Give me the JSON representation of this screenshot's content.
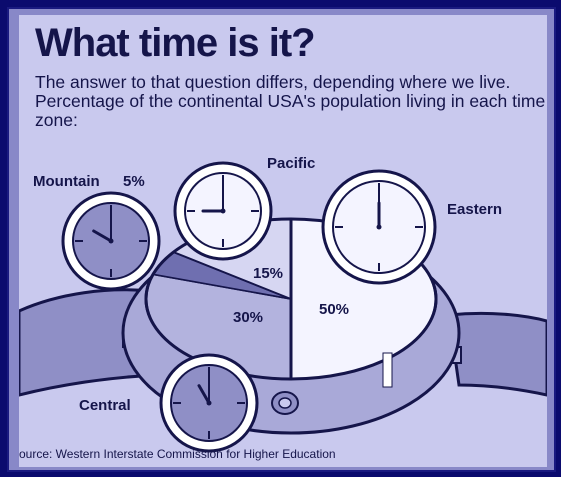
{
  "title": "What time is it?",
  "subtitle": "The answer to that question differs, depending where we live. Percentage of the continental USA's population living in each time zone:",
  "source": "ource:  Western Interstate Commission for Higher Education",
  "colors": {
    "background": "#c9c9ee",
    "ink": "#15154a",
    "band": "#8f8fc6",
    "face_light": "#f4f4ff"
  },
  "chart_data": {
    "type": "pie",
    "title": "What time is it?",
    "categories": [
      "Eastern",
      "Central",
      "Mountain",
      "Pacific"
    ],
    "values": [
      50,
      30,
      5,
      15
    ],
    "labels": [
      "50%",
      "30%",
      "5%",
      "15%"
    ],
    "legend": "none"
  },
  "clocks": [
    {
      "zone": "Mountain",
      "hour": 10,
      "minute": 0
    },
    {
      "zone": "Pacific",
      "hour": 9,
      "minute": 0
    },
    {
      "zone": "Eastern",
      "hour": 12,
      "minute": 0
    },
    {
      "zone": "Central",
      "hour": 11,
      "minute": 0
    }
  ]
}
